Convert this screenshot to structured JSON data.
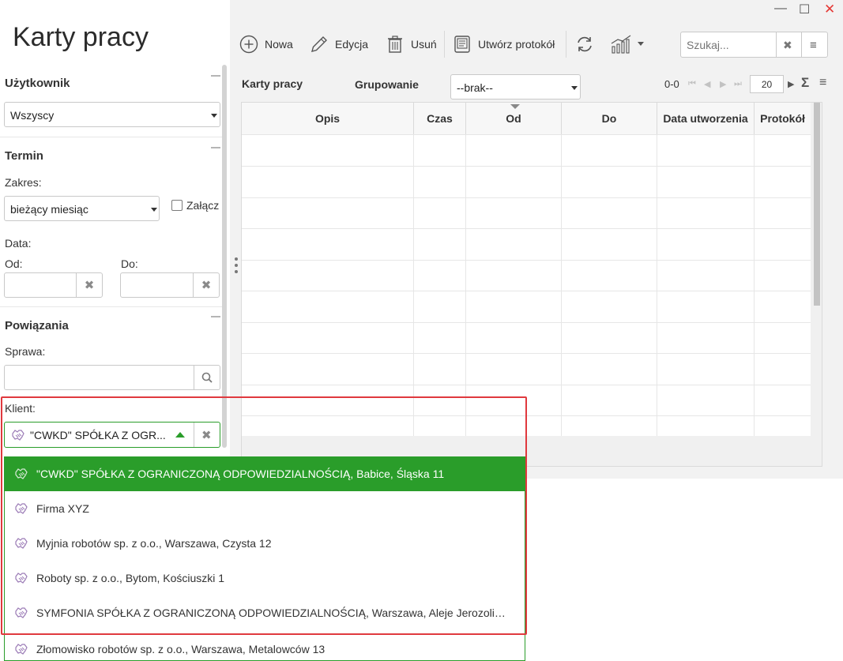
{
  "window": {
    "title": "Karty pracy",
    "minimize_label": "—",
    "maximize_label": "☐",
    "close_label": "✕"
  },
  "filters": {
    "user": {
      "title": "Użytkownik",
      "selected": "Wszyscy"
    },
    "term": {
      "title": "Termin",
      "range_label": "Zakres:",
      "range_selected": "bieżący miesiąc",
      "attach_label": "Załącz",
      "date_label": "Data:",
      "from_label": "Od:",
      "to_label": "Do:",
      "from_value": "",
      "to_value": ""
    },
    "links": {
      "title": "Powiązania",
      "case_label": "Sprawa:",
      "case_value": "",
      "client_label": "Klient:",
      "client_value": "\"CWKD\" SPÓŁKA Z OGR..."
    }
  },
  "toolbar": {
    "new_label": "Nowa",
    "edit_label": "Edycja",
    "delete_label": "Usuń",
    "protocol_label": "Utwórz protokół",
    "search_placeholder": "Szukaj..."
  },
  "grid": {
    "title": "Karty pracy",
    "grouping_label": "Grupowanie",
    "grouping_selected": "--brak--",
    "range_text": "0-0",
    "page_size": "20",
    "sum_symbol": "Σ",
    "columns": [
      "Opis",
      "Czas",
      "Od",
      "Do",
      "Data utworzenia",
      "Protokół"
    ],
    "rows": []
  },
  "client_dropdown": {
    "items": [
      {
        "label": "\"CWKD\" SPÓŁKA Z OGRANICZONĄ ODPOWIEDZIALNOŚCIĄ, Babice, Śląska 11",
        "selected": true
      },
      {
        "label": "Firma XYZ",
        "selected": false
      },
      {
        "label": "Myjnia robotów sp. z o.o., Warszawa, Czysta 12",
        "selected": false
      },
      {
        "label": "Roboty sp. z o.o., Bytom, Kościuszki 1",
        "selected": false
      },
      {
        "label": "SYMFONIA SPÓŁKA Z OGRANICZONĄ ODPOWIEDZIALNOŚCIĄ, Warszawa, Aleje Jerozolimskie...",
        "selected": false
      },
      {
        "label": "Złomowisko robotów sp. z o.o., Warszawa, Metalowców 13",
        "selected": false
      }
    ]
  },
  "colors": {
    "accent_green": "#2a9d2a",
    "highlight_red": "#e0393e",
    "close_red": "#e53935"
  }
}
